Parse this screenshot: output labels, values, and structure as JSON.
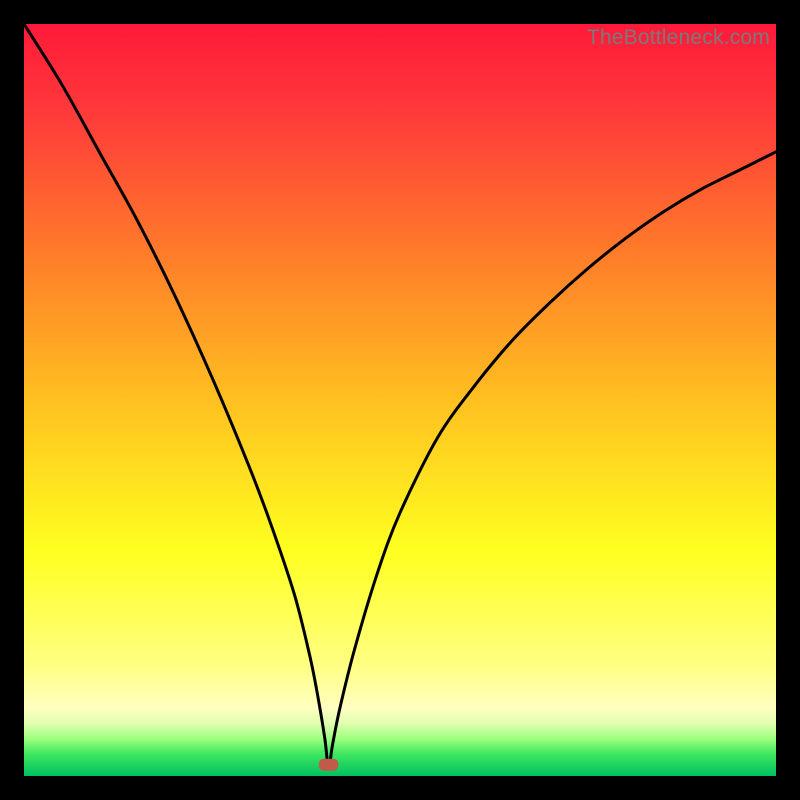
{
  "watermark": {
    "text": "TheBottleneck.com"
  },
  "chart_data": {
    "type": "line",
    "title": "",
    "xlabel": "",
    "ylabel": "",
    "xlim": [
      0,
      100
    ],
    "ylim": [
      0,
      100
    ],
    "grid": false,
    "background_gradient": {
      "stops": [
        {
          "pct": 0,
          "color": "#ff1a3a"
        },
        {
          "pct": 12,
          "color": "#ff3a3a"
        },
        {
          "pct": 30,
          "color": "#ff7a2a"
        },
        {
          "pct": 50,
          "color": "#ffc020"
        },
        {
          "pct": 70,
          "color": "#ffff20"
        },
        {
          "pct": 85,
          "color": "#ffff80"
        },
        {
          "pct": 91,
          "color": "#ffffc0"
        },
        {
          "pct": 93,
          "color": "#e0ffb0"
        },
        {
          "pct": 95,
          "color": "#a0ff80"
        },
        {
          "pct": 97,
          "color": "#40e860"
        },
        {
          "pct": 100,
          "color": "#00c060"
        }
      ]
    },
    "series": [
      {
        "name": "bottleneck-curve",
        "description": "V-shaped curve with minimum at x≈40.5, left branch steeper than right",
        "x": [
          0,
          5,
          10,
          15,
          20,
          25,
          30,
          33,
          36,
          38,
          39,
          40,
          40.5,
          41,
          42,
          44,
          47,
          50,
          55,
          60,
          65,
          70,
          75,
          80,
          85,
          90,
          95,
          100
        ],
        "values": [
          100,
          92,
          83,
          74,
          64,
          53,
          41,
          33,
          24,
          16,
          11,
          5,
          1,
          4,
          9,
          17,
          27,
          35,
          45,
          52,
          58,
          63,
          67.5,
          71.5,
          75,
          78,
          80.5,
          83
        ]
      }
    ],
    "marker": {
      "name": "optimal-point",
      "x": 40.5,
      "y": 1.5,
      "color": "#c05a4a",
      "shape": "rounded-rect",
      "width": 2.6,
      "height": 1.6
    }
  }
}
